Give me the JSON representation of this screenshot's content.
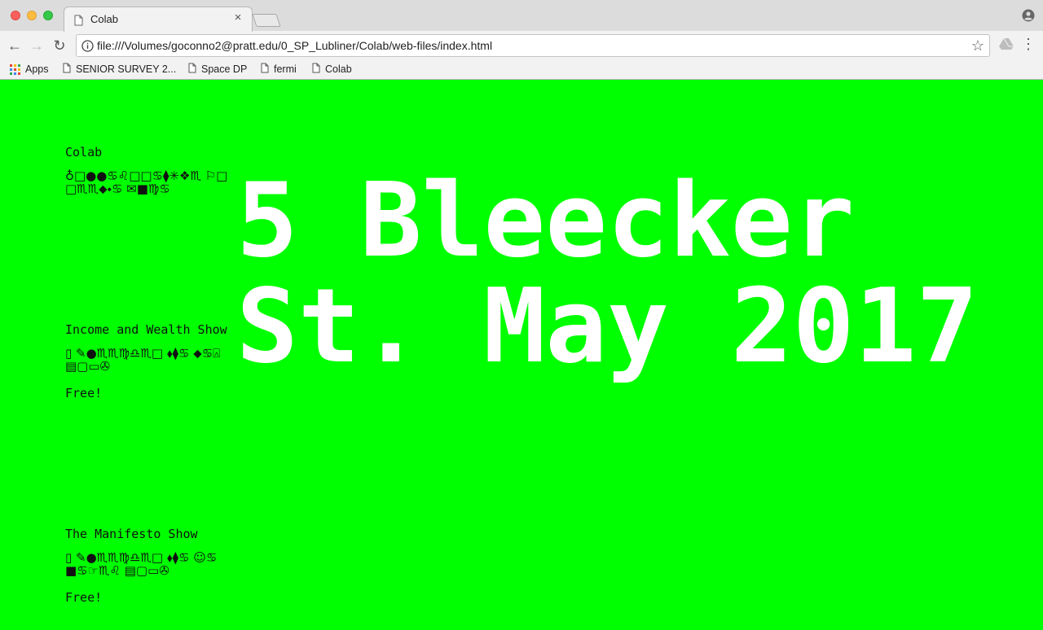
{
  "browser": {
    "tab_title": "Colab",
    "tab_close": "×",
    "url": "file:///Volumes/goconno2@pratt.edu/0_SP_Lubliner/Colab/web-files/index.html",
    "back": "←",
    "forward": "→",
    "reload": "↻",
    "star": "☆",
    "menu": "⋮",
    "bookmarks": [
      {
        "label": "Apps",
        "icon": "apps-grid-icon"
      },
      {
        "label": "SENIOR SURVEY 2...",
        "icon": "page-icon"
      },
      {
        "label": "Space DP",
        "icon": "page-icon"
      },
      {
        "label": "fermi",
        "icon": "page-icon"
      },
      {
        "label": "Colab",
        "icon": "page-icon"
      }
    ]
  },
  "page": {
    "background": "#00ff00",
    "hero_text": "5 Bleecker St. May 2017",
    "hero_line1": "5 Bleecker",
    "hero_line2": "St. May 2017",
    "sections": [
      {
        "title": "Colab",
        "dingbat": "♁□●●♋♌□□♋⧫✳❖♏ ⚐□□♏♏⬥⬩♋ ✉■♍♋",
        "free": ""
      },
      {
        "title": "Income and Wealth Show",
        "dingbat": "▯ ✎●♏♏♍♎♏□ ⬧⧫♋ ⬥♋⍓ ▤▢▭✇",
        "free": "Free!"
      },
      {
        "title": "The Manifesto Show",
        "dingbat": "▯ ✎●♏♏♍♎♏□ ⬧⧫♋ ☺♋■♋☞♏♌ ▤▢▭✇",
        "free": "Free!"
      }
    ]
  },
  "colors": {
    "accent": "#00ff00",
    "hero_text": "#ffffff"
  }
}
